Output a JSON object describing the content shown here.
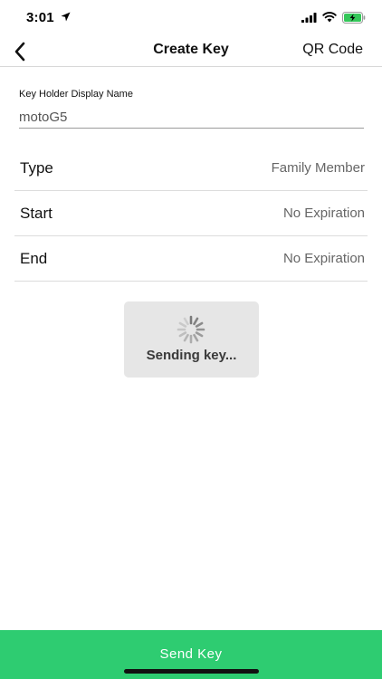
{
  "status_bar": {
    "time": "3:01",
    "icons": [
      "location-arrow-icon",
      "cellular-signal-icon",
      "wifi-icon",
      "battery-charging-icon"
    ],
    "battery_color": "#34c759"
  },
  "nav": {
    "title": "Create Key",
    "back_icon": "chevron-left-icon",
    "qr_label": "QR Code"
  },
  "form": {
    "name_label": "Key Holder Display Name",
    "name_value": "motoG5",
    "rows": [
      {
        "label": "Type",
        "value": "Family Member"
      },
      {
        "label": "Start",
        "value": "No Expiration"
      },
      {
        "label": "End",
        "value": "No Expiration"
      }
    ]
  },
  "loading": {
    "icon": "spinner-icon",
    "text": "Sending key..."
  },
  "footer": {
    "send_label": "Send Key",
    "button_color": "#2ecc71"
  }
}
